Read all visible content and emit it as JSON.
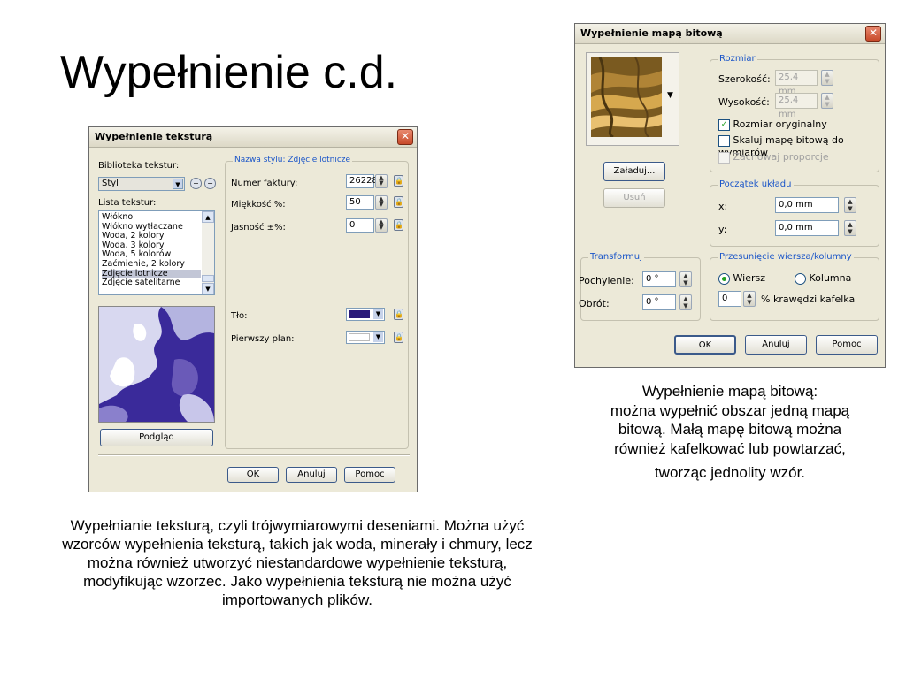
{
  "slide": {
    "title": "Wypełnienie c.d.",
    "caption_left": "Wypełnianie teksturą, czyli trójwymiarowymi deseniami. Można użyć wzorców wypełnienia teksturą, takich jak woda, minerały i chmury, lecz można również utworzyć niestandardowe wypełnienie teksturą, modyfikując wzorzec. Jako wypełnienia teksturą nie można użyć importowanych plików.",
    "caption_right_lines": [
      "Wypełnienie mapą bitową:",
      "można wypełnić obszar jedną mapą",
      "bitową. Małą mapę bitową można",
      "również kafelkować lub powtarzać,"
    ],
    "caption_right_last": "tworząc jednolity wzór."
  },
  "texture_dialog": {
    "title": "Wypełnienie teksturą",
    "library_label": "Biblioteka tekstur:",
    "library_value": "Styl",
    "list_label": "Lista tekstur:",
    "list_items": [
      "Włókno",
      "Włókno wytłaczane",
      "Woda, 2 kolory",
      "Woda, 3 kolory",
      "Woda, 5 kolorów",
      "Zaćmienie, 2 kolory",
      "Zdjęcie lotnicze",
      "Zdjęcie satelitarne"
    ],
    "selected_item": "Zdjęcie lotnicze",
    "style_group_label": "Nazwa stylu: Zdjęcie lotnicze",
    "params": [
      {
        "label": "Numer faktury:",
        "value": "26228"
      },
      {
        "label": "Miękkość %:",
        "value": "50"
      },
      {
        "label": "Jasność ±%:",
        "value": "0"
      }
    ],
    "background_label": "Tło:",
    "foreground_label": "Pierwszy plan:",
    "background_color": "#2a1a7a",
    "foreground_color": "#ffffff",
    "preview_button": "Podgląd",
    "ok": "OK",
    "cancel": "Anuluj",
    "help": "Pomoc"
  },
  "bitmap_dialog": {
    "title": "Wypełnienie mapą bitową",
    "load_button": "Załaduj...",
    "remove_button": "Usuń",
    "size_group": "Rozmiar",
    "width_label": "Szerokość:",
    "width_value": "25,4 mm",
    "height_label": "Wysokość:",
    "height_value": "25,4 mm",
    "original_size": "Rozmiar oryginalny",
    "scale_bitmap": "Skaluj mapę bitową do wymiarów",
    "keep_proportions": "Zachowaj proporcje",
    "origin_group": "Początek układu",
    "x_label": "x:",
    "x_value": "0,0 mm",
    "y_label": "y:",
    "y_value": "0,0 mm",
    "transform_group": "Transformuj",
    "skew_label": "Pochylenie:",
    "skew_value": "0 °",
    "rotate_label": "Obrót:",
    "rotate_value": "0 °",
    "offset_group": "Przesunięcie wiersza/kolumny",
    "row_label": "Wiersz",
    "column_label": "Kolumna",
    "offset_value": "0",
    "offset_suffix": "% krawędzi kafelka",
    "ok": "OK",
    "cancel": "Anuluj",
    "help": "Pomoc"
  }
}
